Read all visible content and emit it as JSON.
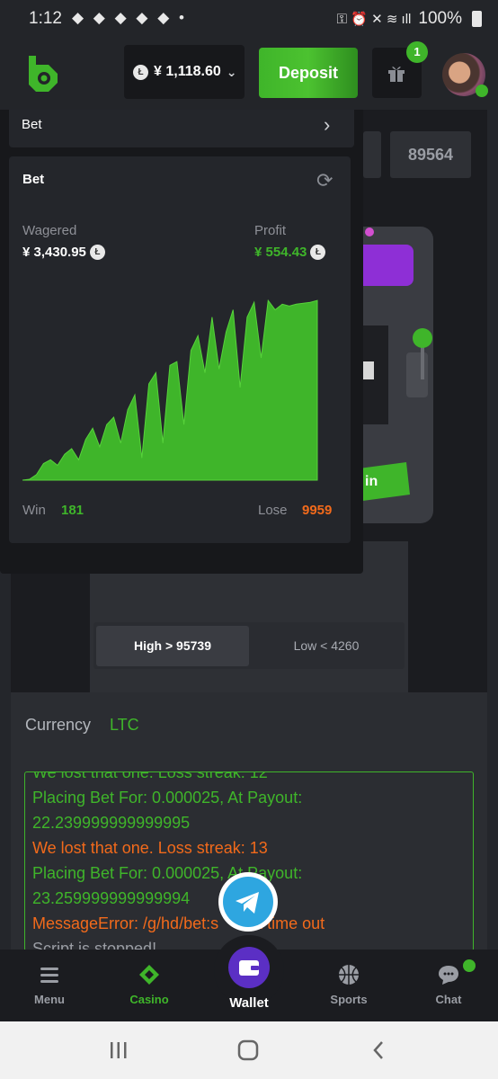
{
  "status_bar": {
    "time": "1:12",
    "notifications": "◆ ◆ ◆ ◆ ◆ •",
    "battery": "100%"
  },
  "header": {
    "balance": "¥ 1,118.60",
    "currency_icon": "litecoin-icon",
    "deposit_label": "Deposit",
    "gift_badge": "1"
  },
  "game": {
    "number_display": "89564",
    "high_label": "High > 95739",
    "low_label": "Low < 4260"
  },
  "panel": {
    "bet_row_label": "Bet",
    "stats_title": "Bet",
    "wagered_label": "Wagered",
    "wagered_value": "¥ 3,430.95",
    "profit_label": "Profit",
    "profit_value": "¥ 554.43",
    "win_label": "Win",
    "win_value": "181",
    "lose_label": "Lose",
    "lose_value": "9959"
  },
  "chart_data": {
    "type": "area",
    "series": [
      {
        "values": [
          0,
          0.5,
          3,
          9,
          11,
          8,
          14,
          17,
          11,
          22,
          28,
          18,
          30,
          34,
          20,
          38,
          46,
          12,
          52,
          58,
          20,
          62,
          64,
          30,
          70,
          78,
          58,
          88,
          60,
          80,
          92,
          50,
          88,
          96,
          66,
          97,
          92,
          95,
          94,
          95,
          95.5,
          96,
          97
        ]
      }
    ],
    "colors": {
      "fill": "#3fb52a"
    }
  },
  "lower": {
    "currency_label": "Currency",
    "currency_value": "LTC",
    "console_lines": [
      {
        "text": "We lost that one. Loss streak: 12",
        "color": "g"
      },
      {
        "text": "Placing Bet For: 0.000025, At Payout:",
        "color": "g"
      },
      {
        "text": "22.239999999999995",
        "color": "g"
      },
      {
        "text": "We lost that one. Loss streak: 13",
        "color": "o"
      },
      {
        "text": "Placing Bet For: 0.000025, At Payout:",
        "color": "g"
      },
      {
        "text": "23.259999999999994",
        "color": "g"
      },
      {
        "text": "MessageError: /g/hd/bet:s        k time out",
        "color": "o"
      },
      {
        "text": "Script is stopped!",
        "color": "w"
      }
    ]
  },
  "bottom_nav": {
    "items": [
      {
        "label": "Menu",
        "icon": "menu-icon"
      },
      {
        "label": "Casino",
        "icon": "casino-icon"
      },
      {
        "label": "Wallet",
        "icon": "wallet-icon"
      },
      {
        "label": "Sports",
        "icon": "basketball-icon"
      },
      {
        "label": "Chat",
        "icon": "chat-icon"
      }
    ]
  },
  "colors": {
    "accent": "#3fb52a",
    "loss": "#f26a1b",
    "wallet": "#5b2fc4",
    "telegram": "#2ea6e0"
  }
}
